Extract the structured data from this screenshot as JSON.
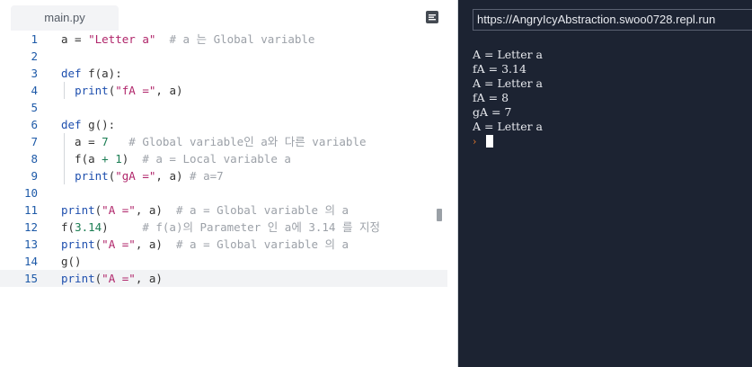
{
  "editor": {
    "tab_label": "main.py",
    "lines": [
      {
        "n": "1",
        "tokens": [
          [
            "",
            "a = "
          ],
          [
            "str",
            "\"Letter a\""
          ],
          [
            "",
            "  "
          ],
          [
            "cm",
            "# a 는 Global variable"
          ]
        ]
      },
      {
        "n": "2",
        "tokens": []
      },
      {
        "n": "3",
        "tokens": [
          [
            "kw",
            "def"
          ],
          [
            "",
            " f(a):"
          ]
        ]
      },
      {
        "n": "4",
        "tokens": [
          [
            "",
            "  "
          ],
          [
            "kw",
            "print"
          ],
          [
            "",
            "("
          ],
          [
            "str",
            "\"fA =\""
          ],
          [
            "",
            ", a)"
          ]
        ]
      },
      {
        "n": "5",
        "tokens": []
      },
      {
        "n": "6",
        "tokens": [
          [
            "kw",
            "def"
          ],
          [
            "",
            " g():"
          ]
        ]
      },
      {
        "n": "7",
        "tokens": [
          [
            "",
            "  a = "
          ],
          [
            "num",
            "7"
          ],
          [
            "",
            "   "
          ],
          [
            "cm",
            "# Global variable인 a와 다른 variable"
          ]
        ]
      },
      {
        "n": "8",
        "tokens": [
          [
            "",
            "  f(a "
          ],
          [
            "op",
            "+"
          ],
          [
            "",
            " "
          ],
          [
            "num",
            "1"
          ],
          [
            "",
            ")  "
          ],
          [
            "cm",
            "# a = Local variable a"
          ]
        ]
      },
      {
        "n": "9",
        "tokens": [
          [
            "",
            "  "
          ],
          [
            "kw",
            "print"
          ],
          [
            "",
            "("
          ],
          [
            "str",
            "\"gA =\""
          ],
          [
            "",
            ", a) "
          ],
          [
            "cm",
            "# a=7"
          ]
        ]
      },
      {
        "n": "10",
        "tokens": []
      },
      {
        "n": "11",
        "tokens": [
          [
            "kw",
            "print"
          ],
          [
            "",
            "("
          ],
          [
            "str",
            "\"A =\""
          ],
          [
            "",
            ", a)  "
          ],
          [
            "cm",
            "# a = Global variable 의 a"
          ]
        ]
      },
      {
        "n": "12",
        "tokens": [
          [
            "",
            "f("
          ],
          [
            "num",
            "3.14"
          ],
          [
            "",
            ")     "
          ],
          [
            "cm",
            "# f(a)의 Parameter 인 a에 3.14 를 지정"
          ]
        ]
      },
      {
        "n": "13",
        "tokens": [
          [
            "kw",
            "print"
          ],
          [
            "",
            "("
          ],
          [
            "str",
            "\"A =\""
          ],
          [
            "",
            ", a)  "
          ],
          [
            "cm",
            "# a = Global variable 의 a"
          ]
        ]
      },
      {
        "n": "14",
        "tokens": [
          [
            "",
            "g()"
          ]
        ]
      },
      {
        "n": "15",
        "tokens": [
          [
            "kw",
            "print"
          ],
          [
            "",
            "("
          ],
          [
            "str",
            "\"A =\""
          ],
          [
            "",
            ", a)"
          ]
        ]
      }
    ],
    "active_line": "15"
  },
  "console": {
    "url": "https://AngryIcyAbstraction.swoo0728.repl.run",
    "output": [
      "A = Letter a",
      "fA = 3.14",
      "A = Letter a",
      "fA = 8",
      "gA = 7",
      "A = Letter a"
    ],
    "prompt_symbol": "›"
  },
  "colors": {
    "keyword": "#1e4fae",
    "string": "#b0256a",
    "number": "#1b7d53",
    "comment": "#9ca1a8",
    "console_bg": "#1c2332",
    "prompt": "#f07c2a",
    "accent": "#3fbf6a"
  },
  "icons": {
    "menu": "list-menu-icon"
  }
}
